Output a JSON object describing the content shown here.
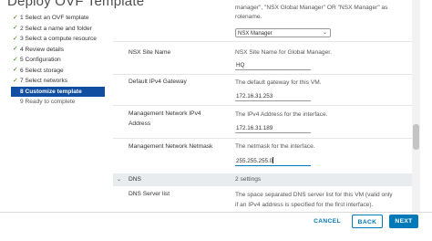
{
  "window": {
    "title": "Deploy OVF Template"
  },
  "steps": [
    {
      "label": "1 Select an OVF template",
      "state": "done"
    },
    {
      "label": "2 Select a name and folder",
      "state": "done"
    },
    {
      "label": "3 Select a compute resource",
      "state": "done"
    },
    {
      "label": "4 Review details",
      "state": "done"
    },
    {
      "label": "5 Configuration",
      "state": "done"
    },
    {
      "label": "6 Select storage",
      "state": "done"
    },
    {
      "label": "7 Select networks",
      "state": "done"
    },
    {
      "label": "8 Customize template",
      "state": "active"
    },
    {
      "label": "9 Ready to complete",
      "state": "pending"
    }
  ],
  "rolename": {
    "hint_line1": "manager\", \"NSX Global Manager\" OR \"NSX Manager\" as",
    "hint_line2": "rolename.",
    "selected": "NSX Manager"
  },
  "site_name": {
    "label": "NSX Site Name",
    "hint": "NSX Site Name for Global Manager.",
    "value": "HQ"
  },
  "gateway": {
    "label": "Default IPv4 Gateway",
    "hint": "The default gateway for this VM.",
    "value": "172.16.31.253"
  },
  "mgmt_ip": {
    "label_line1": "Management Network IPv4",
    "label_line2": "Address",
    "hint": "The IPv4 Address for the interface.",
    "value": "172.16.31.189"
  },
  "netmask": {
    "label": "Management Network Netmask",
    "hint": "The netmask for the interface.",
    "value": "255.255.255.0"
  },
  "dns": {
    "section": "DNS",
    "count": "2 settings",
    "server_label": "DNS Server list",
    "hint_line1": "The space separated DNS server list for this VM (valid only",
    "hint_line2": "if an IPv4 address is specified for the first interface)."
  },
  "buttons": {
    "cancel": "CANCEL",
    "back": "BACK",
    "next": "NEXT"
  },
  "colors": {
    "accent": "#0079b8",
    "active_step": "#0f4ea0",
    "check": "#2f8400"
  },
  "icons": {
    "step_done": "check-icon",
    "dropdown": "chevron-down-icon",
    "section_toggle": "chevron-down-icon"
  }
}
